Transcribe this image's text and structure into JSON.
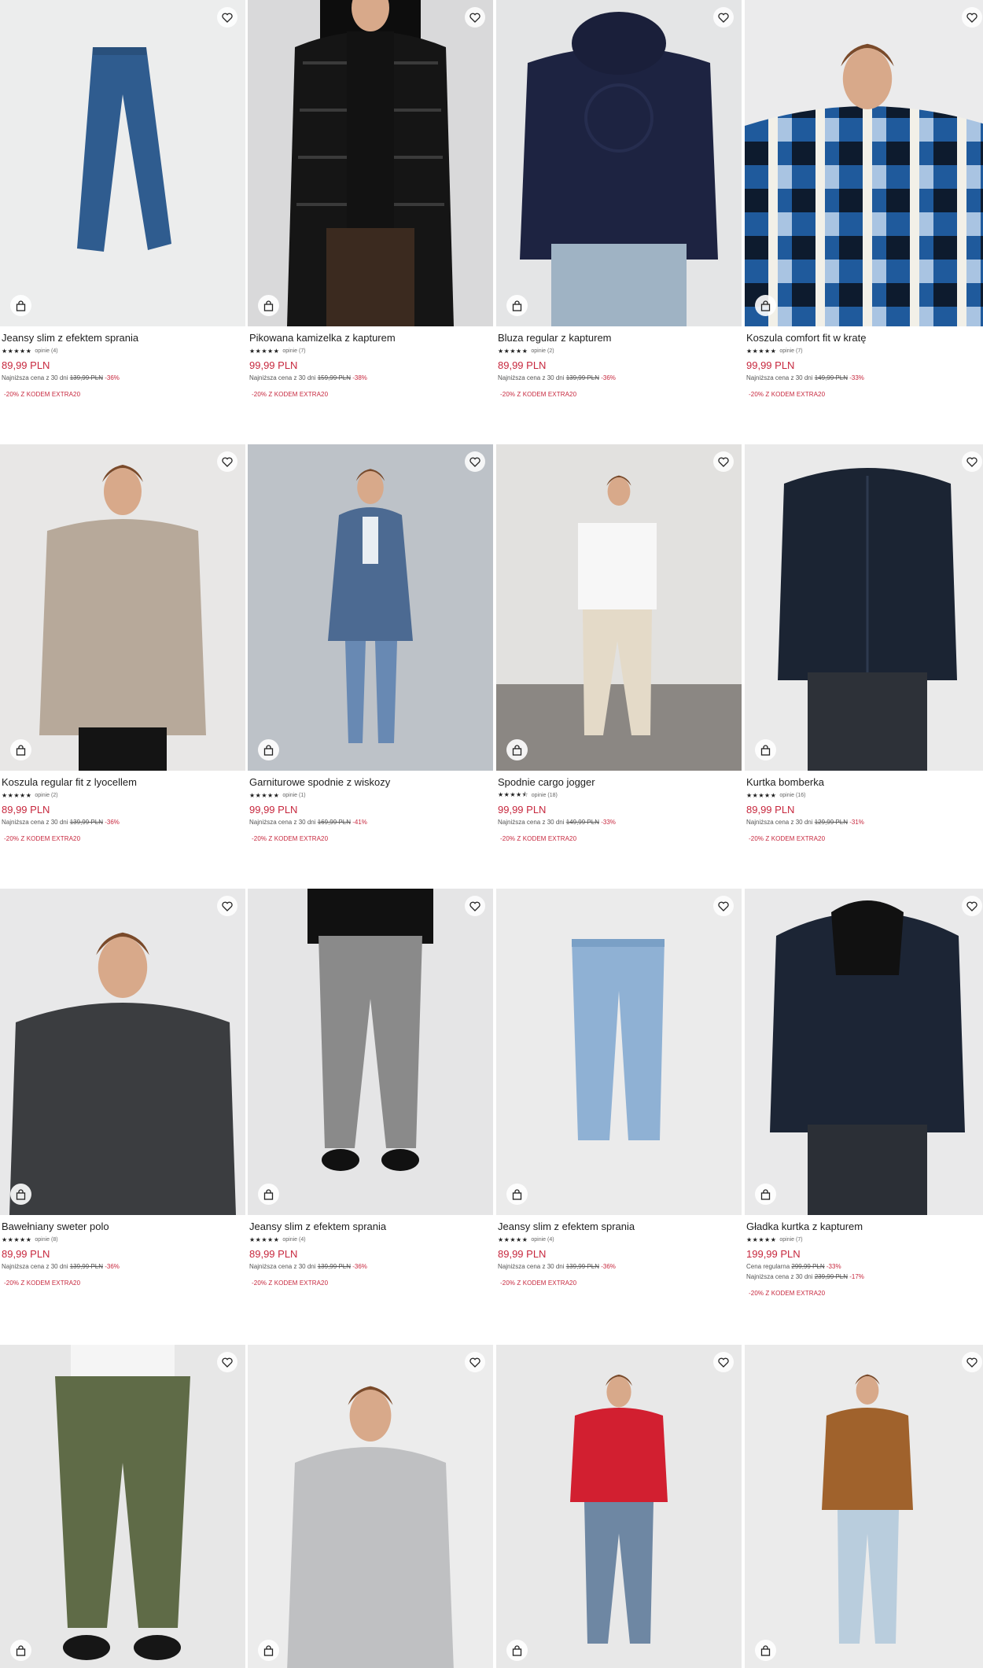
{
  "colors": {
    "price": "#c7283e",
    "text": "#1e1e1e",
    "muted": "#555555"
  },
  "icons": {
    "wishlist": "heart-icon",
    "cart": "shopping-bag-icon",
    "rating": "star-icon"
  },
  "products": [
    {
      "name": "Jeansy slim z efektem sprania",
      "stars": "★★★★★",
      "reviews": "opinie (4)",
      "price": "89,99 PLN",
      "lowest_label": "Najniższa cena z 30 dni",
      "old_price": "139,99 PLN",
      "discount": "-36%",
      "promo": "-20% Z KODEM EXTRA20",
      "image": "jeans-dark"
    },
    {
      "name": "Pikowana kamizelka z kapturem",
      "stars": "★★★★★",
      "reviews": "opinie (7)",
      "price": "99,99 PLN",
      "lowest_label": "Najniższa cena z 30 dni",
      "old_price": "159,99 PLN",
      "discount": "-38%",
      "promo": "-20% Z KODEM EXTRA20",
      "image": "vest-black"
    },
    {
      "name": "Bluza regular z kapturem",
      "stars": "★★★★★",
      "reviews": "opinie (2)",
      "price": "89,99 PLN",
      "lowest_label": "Najniższa cena z 30 dni",
      "old_price": "139,99 PLN",
      "discount": "-36%",
      "promo": "-20% Z KODEM EXTRA20",
      "image": "hoodie-navy"
    },
    {
      "name": "Koszula comfort fit w kratę",
      "stars": "★★★★★",
      "reviews": "opinie (7)",
      "price": "99,99 PLN",
      "lowest_label": "Najniższa cena z 30 dni",
      "old_price": "149,99 PLN",
      "discount": "-33%",
      "promo": "-20% Z KODEM EXTRA20",
      "image": "shirt-plaid"
    },
    {
      "name": "Koszula regular fit z lyocellem",
      "stars": "★★★★★",
      "reviews": "opinie (2)",
      "price": "89,99 PLN",
      "lowest_label": "Najniższa cena z 30 dni",
      "old_price": "139,99 PLN",
      "discount": "-36%",
      "promo": "-20% Z KODEM EXTRA20",
      "image": "shirt-beige"
    },
    {
      "name": "Garniturowe spodnie z wiskozy",
      "stars": "★★★★★",
      "reviews": "opinie (1)",
      "price": "99,99 PLN",
      "lowest_label": "Najniższa cena z 30 dni",
      "old_price": "169,99 PLN",
      "discount": "-41%",
      "promo": "-20% Z KODEM EXTRA20",
      "image": "suit-blue"
    },
    {
      "name": "Spodnie cargo jogger",
      "stars": "★★★★⯪",
      "reviews": "opinie (18)",
      "price": "99,99 PLN",
      "lowest_label": "Najniższa cena z 30 dni",
      "old_price": "149,99 PLN",
      "discount": "-33%",
      "promo": "-20% Z KODEM EXTRA20",
      "image": "cargo-beige"
    },
    {
      "name": "Kurtka bomberka",
      "stars": "★★★★★",
      "reviews": "opinie (16)",
      "price": "89,99 PLN",
      "lowest_label": "Najniższa cena z 30 dni",
      "old_price": "129,99 PLN",
      "discount": "-31%",
      "promo": "-20% Z KODEM EXTRA20",
      "image": "bomber-navy"
    },
    {
      "name": "Bawełniany sweter polo",
      "stars": "★★★★★",
      "reviews": "opinie (8)",
      "price": "89,99 PLN",
      "lowest_label": "Najniższa cena z 30 dni",
      "old_price": "139,99 PLN",
      "discount": "-36%",
      "promo": "-20% Z KODEM EXTRA20",
      "image": "sweater-grey"
    },
    {
      "name": "Jeansy slim z efektem sprania",
      "stars": "★★★★★",
      "reviews": "opinie (4)",
      "price": "89,99 PLN",
      "lowest_label": "Najniższa cena z 30 dni",
      "old_price": "139,99 PLN",
      "discount": "-36%",
      "promo": "-20% Z KODEM EXTRA20",
      "image": "jeans-grey"
    },
    {
      "name": "Jeansy slim z efektem sprania",
      "stars": "★★★★★",
      "reviews": "opinie (4)",
      "price": "89,99 PLN",
      "lowest_label": "Najniższa cena z 30 dni",
      "old_price": "139,99 PLN",
      "discount": "-36%",
      "promo": "-20% Z KODEM EXTRA20",
      "image": "jeans-light"
    },
    {
      "name": "Gładka kurtka z kapturem",
      "stars": "★★★★★",
      "reviews": "opinie (7)",
      "price": "199,99 PLN",
      "regular_label": "Cena regularna",
      "regular_price": "299,99 PLN",
      "regular_discount": "-33%",
      "lowest_label": "Najniższa cena z 30 dni",
      "old_price": "239,99 PLN",
      "discount": "-17%",
      "promo": "-20% Z KODEM EXTRA20",
      "image": "jacket-hood-navy"
    },
    {
      "name": "",
      "image": "cargo-khaki"
    },
    {
      "name": "",
      "image": "overshirt-grey"
    },
    {
      "name": "",
      "image": "vest-red"
    },
    {
      "name": "",
      "image": "jacket-camel"
    }
  ]
}
